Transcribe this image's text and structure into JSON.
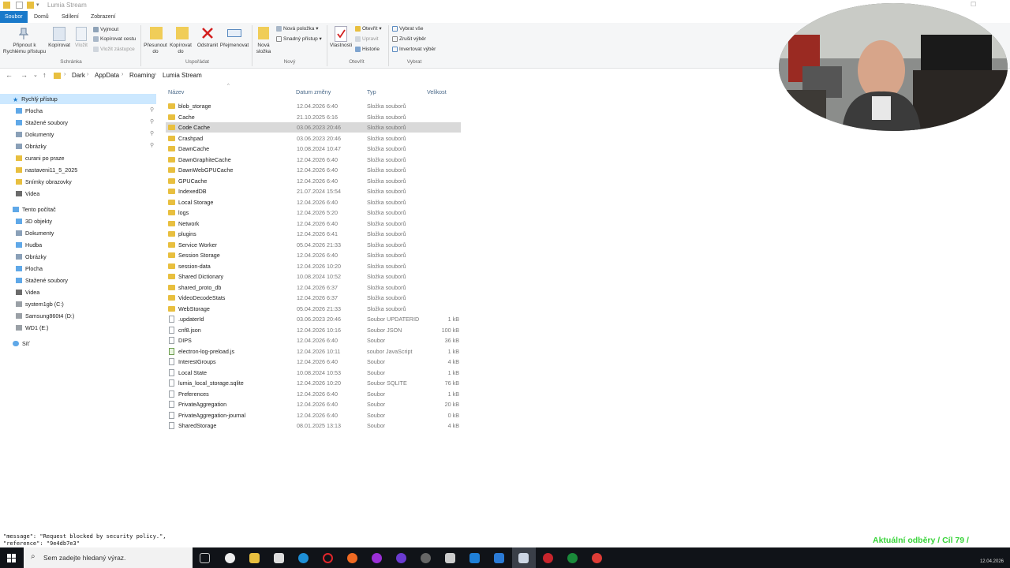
{
  "window": {
    "title": "Lumia Stream"
  },
  "ribbon_tabs": [
    "Soubor",
    "Domů",
    "Sdílení",
    "Zobrazení"
  ],
  "ribbon": {
    "pin": "Připnout k Rychlému přístupu",
    "copy": "Kopírovat",
    "paste": "Vložit",
    "cut": "Vyjmout",
    "copy_path": "Kopírovat cestu",
    "paste_shortcut": "Vložit zástupce",
    "group_clipboard": "Schránka",
    "move_to": "Přesunout do",
    "copy_to": "Kopírovat do",
    "delete": "Odstranit",
    "rename": "Přejmenovat",
    "group_organize": "Uspořádat",
    "new_folder": "Nová složka",
    "new_item": "Nová položka",
    "easy_access": "Snadný přístup",
    "group_new": "Nový",
    "properties": "Vlastnosti",
    "open": "Otevřít",
    "edit": "Upravit",
    "history": "Historie",
    "group_open": "Otevřít",
    "select_all": "Vybrat vše",
    "select_none": "Zrušit výběr",
    "invert_selection": "Invertovat výběr",
    "group_select": "Vybrat"
  },
  "breadcrumb": [
    "Dark",
    "AppData",
    "Roaming",
    "Lumia Stream"
  ],
  "nav": {
    "quick_access": "Rychlý přístup",
    "quick_items": [
      "Plocha",
      "Stažené soubory",
      "Dokumenty",
      "Obrázky",
      "curani po praze",
      "nastaveni11_5_2025",
      "Snímky obrazovky",
      "Videa"
    ],
    "this_pc": "Tento počítač",
    "pc_items": [
      "3D objekty",
      "Dokumenty",
      "Hudba",
      "Obrázky",
      "Plocha",
      "Stažené soubory",
      "Videa",
      "system1gb (C:)",
      "Samsung860t4 (D:)",
      "WD1 (E:)"
    ],
    "network": "Síť"
  },
  "columns": {
    "name": "Název",
    "date": "Datum změny",
    "type": "Typ",
    "size": "Velikost"
  },
  "files": [
    {
      "name": "blob_storage",
      "date": "12.04.2026 6:40",
      "type": "Složka souborů",
      "size": "",
      "kind": "folder"
    },
    {
      "name": "Cache",
      "date": "21.10.2025 6:16",
      "type": "Složka souborů",
      "size": "",
      "kind": "folder"
    },
    {
      "name": "Code Cache",
      "date": "03.06.2023 20:46",
      "type": "Složka souborů",
      "size": "",
      "kind": "folder"
    },
    {
      "name": "Crashpad",
      "date": "03.06.2023 20:46",
      "type": "Složka souborů",
      "size": "",
      "kind": "folder"
    },
    {
      "name": "DawnCache",
      "date": "10.08.2024 10:47",
      "type": "Složka souborů",
      "size": "",
      "kind": "folder"
    },
    {
      "name": "DawnGraphiteCache",
      "date": "12.04.2026 6:40",
      "type": "Složka souborů",
      "size": "",
      "kind": "folder"
    },
    {
      "name": "DawnWebGPUCache",
      "date": "12.04.2026 6:40",
      "type": "Složka souborů",
      "size": "",
      "kind": "folder"
    },
    {
      "name": "GPUCache",
      "date": "12.04.2026 6:40",
      "type": "Složka souborů",
      "size": "",
      "kind": "folder"
    },
    {
      "name": "IndexedDB",
      "date": "21.07.2024 15:54",
      "type": "Složka souborů",
      "size": "",
      "kind": "folder"
    },
    {
      "name": "Local Storage",
      "date": "12.04.2026 6:40",
      "type": "Složka souborů",
      "size": "",
      "kind": "folder"
    },
    {
      "name": "logs",
      "date": "12.04.2026 5:20",
      "type": "Složka souborů",
      "size": "",
      "kind": "folder"
    },
    {
      "name": "Network",
      "date": "12.04.2026 6:40",
      "type": "Složka souborů",
      "size": "",
      "kind": "folder"
    },
    {
      "name": "plugins",
      "date": "12.04.2026 6:41",
      "type": "Složka souborů",
      "size": "",
      "kind": "folder"
    },
    {
      "name": "Service Worker",
      "date": "05.04.2026 21:33",
      "type": "Složka souborů",
      "size": "",
      "kind": "folder"
    },
    {
      "name": "Session Storage",
      "date": "12.04.2026 6:40",
      "type": "Složka souborů",
      "size": "",
      "kind": "folder"
    },
    {
      "name": "session-data",
      "date": "12.04.2026 10:20",
      "type": "Složka souborů",
      "size": "",
      "kind": "folder"
    },
    {
      "name": "Shared Dictionary",
      "date": "10.08.2024 10:52",
      "type": "Složka souborů",
      "size": "",
      "kind": "folder"
    },
    {
      "name": "shared_proto_db",
      "date": "12.04.2026 6:37",
      "type": "Složka souborů",
      "size": "",
      "kind": "folder"
    },
    {
      "name": "VideoDecodeStats",
      "date": "12.04.2026 6:37",
      "type": "Složka souborů",
      "size": "",
      "kind": "folder"
    },
    {
      "name": "WebStorage",
      "date": "05.04.2026 21:33",
      "type": "Složka souborů",
      "size": "",
      "kind": "folder"
    },
    {
      "name": ".updaterId",
      "date": "03.06.2023 20:46",
      "type": "Soubor UPDATERID",
      "size": "1 kB",
      "kind": "file"
    },
    {
      "name": "cnf8.json",
      "date": "12.04.2026 10:16",
      "type": "Soubor JSON",
      "size": "100 kB",
      "kind": "file"
    },
    {
      "name": "DIPS",
      "date": "12.04.2026 6:40",
      "type": "Soubor",
      "size": "36 kB",
      "kind": "file"
    },
    {
      "name": "electron-log-preload.js",
      "date": "12.04.2026 10:11",
      "type": "soubor JavaScript",
      "size": "1 kB",
      "kind": "js"
    },
    {
      "name": "InterestGroups",
      "date": "12.04.2026 6:40",
      "type": "Soubor",
      "size": "4 kB",
      "kind": "file"
    },
    {
      "name": "Local State",
      "date": "10.08.2024 10:53",
      "type": "Soubor",
      "size": "1 kB",
      "kind": "file"
    },
    {
      "name": "lumia_local_storage.sqlite",
      "date": "12.04.2026 10:20",
      "type": "Soubor SQLITE",
      "size": "76 kB",
      "kind": "file"
    },
    {
      "name": "Preferences",
      "date": "12.04.2026 6:40",
      "type": "Soubor",
      "size": "1 kB",
      "kind": "file"
    },
    {
      "name": "PrivateAggregation",
      "date": "12.04.2026 6:40",
      "type": "Soubor",
      "size": "20 kB",
      "kind": "file"
    },
    {
      "name": "PrivateAggregation-journal",
      "date": "12.04.2026 6:40",
      "type": "Soubor",
      "size": "0 kB",
      "kind": "file"
    },
    {
      "name": "SharedStorage",
      "date": "08.01.2025 13:13",
      "type": "Soubor",
      "size": "4 kB",
      "kind": "file"
    }
  ],
  "selected_file_index": 2,
  "console": {
    "line1": "\"message\": \"Request blocked by security policy.\",",
    "line2": "\"reference\": \"9e4db7e3\""
  },
  "overlay_goal": "Aktuální odběry / Cíl 79 / ",
  "taskbar": {
    "search_placeholder": "Sem zadejte hledaný výraz.",
    "clock": "12.04.2026"
  },
  "colors": {
    "accent": "#1979ca",
    "folder": "#e8bf3f",
    "selection": "#d9d9d9",
    "nav_selection": "#cce8ff",
    "goal_green": "#39d43a"
  }
}
